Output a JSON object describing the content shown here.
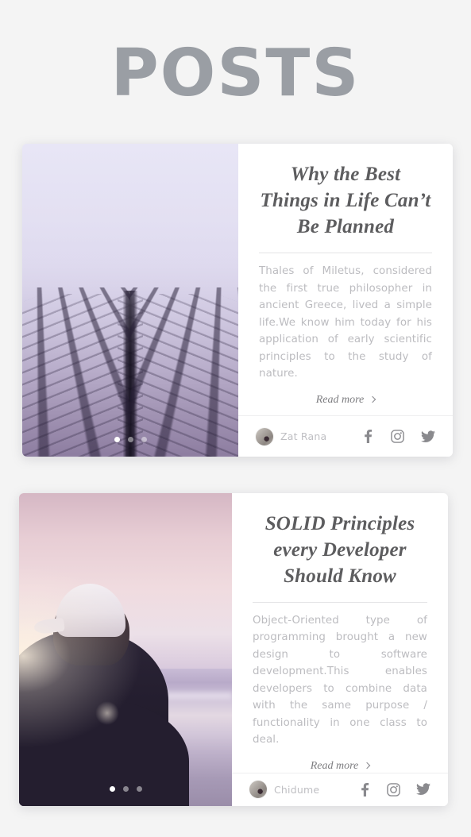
{
  "header": {
    "title": "POSTS"
  },
  "theme": {
    "page_background": "#f4f4f4",
    "title_color": "#9a9ea4",
    "card_background": "#ffffff",
    "post_title_color": "#5d5d5f",
    "excerpt_color": "#bcbcc0",
    "author_color": "#bfbfc3",
    "social_icon_color": "#8a8a8e",
    "divider_color": "#e4e4e6"
  },
  "posts": [
    {
      "title": "Why the Best Things in Life Can’t Be Planned",
      "excerpt": "Thales of Miletus, considered the first true philosopher in ancient Greece, lived a simple life.We know him today for his application of early scientific principles to the study of nature.",
      "read_more_label": "Read more",
      "read_more_icon": "chevron-right-icon",
      "author": "Zat Rana",
      "avatar_icon": "author-avatar",
      "image_alt": "skyscraper-upward-perspective-photo",
      "carousel": {
        "total": 3,
        "active_index": 0
      },
      "socials": [
        {
          "name": "facebook-icon",
          "label": "Facebook"
        },
        {
          "name": "instagram-icon",
          "label": "Instagram"
        },
        {
          "name": "twitter-icon",
          "label": "Twitter"
        }
      ]
    },
    {
      "title": "SOLID Principles every Developer Should Know",
      "excerpt": "Object-Oriented type of programming brought a new design to software development.This enables developers to combine data with the same purpose / functionality in one class to deal.",
      "read_more_label": "Read more",
      "read_more_icon": "chevron-right-icon",
      "author": "Chidume",
      "avatar_icon": "author-avatar",
      "image_alt": "person-in-white-cap-at-beach-sunset-photo",
      "carousel": {
        "total": 3,
        "active_index": 0
      },
      "socials": [
        {
          "name": "facebook-icon",
          "label": "Facebook"
        },
        {
          "name": "instagram-icon",
          "label": "Instagram"
        },
        {
          "name": "twitter-icon",
          "label": "Twitter"
        }
      ]
    }
  ]
}
